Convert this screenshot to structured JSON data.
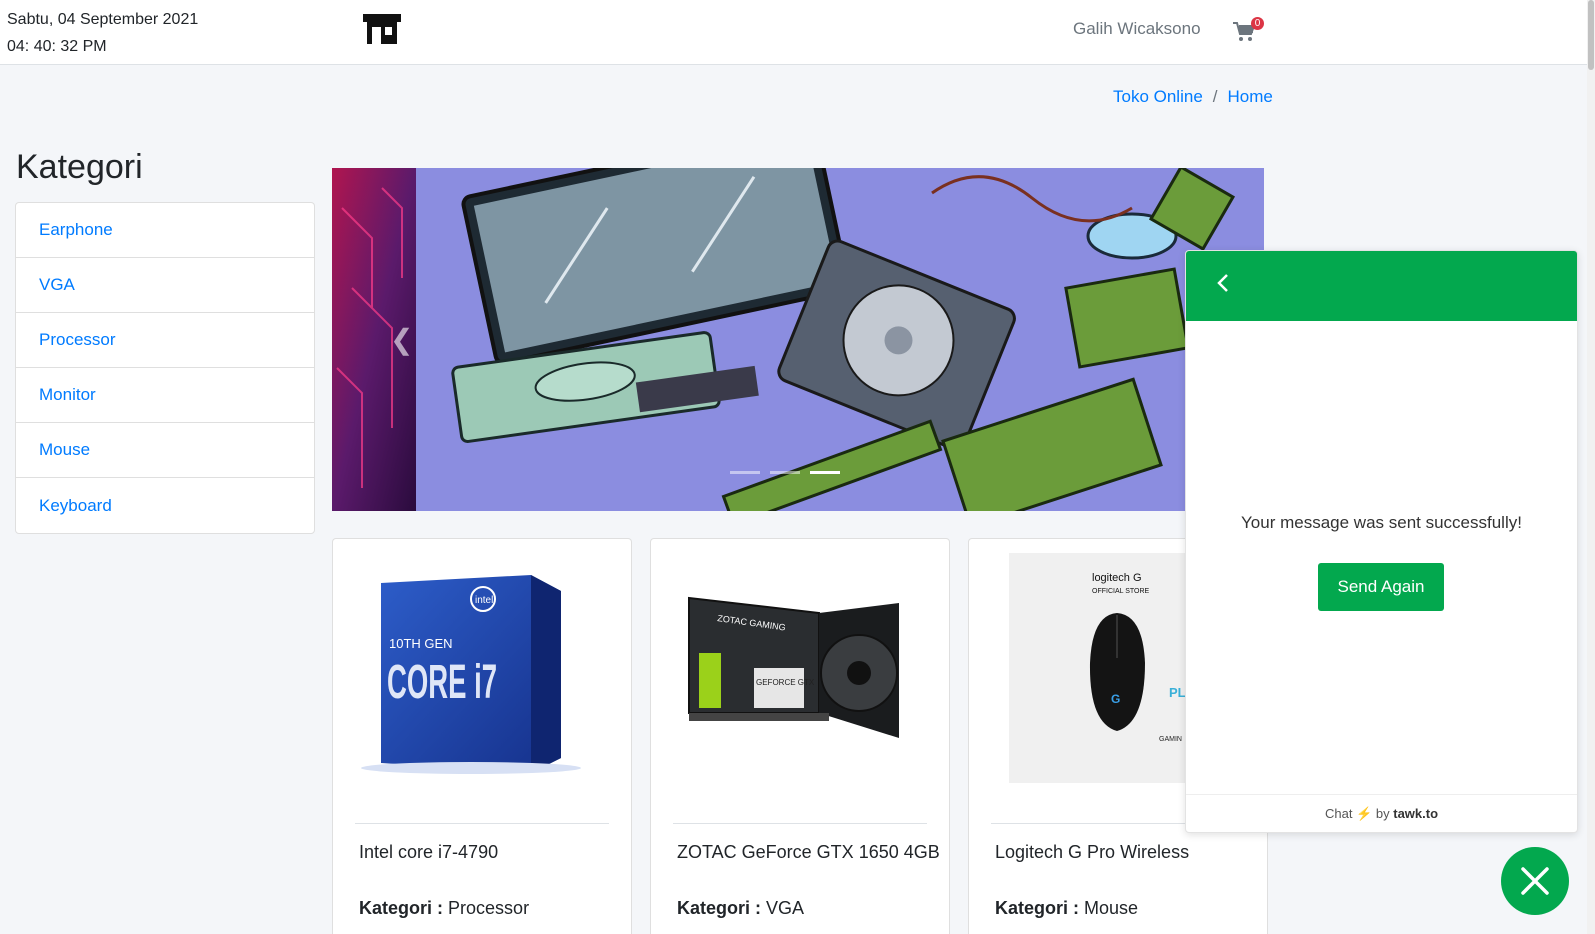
{
  "header": {
    "date": "Sabtu, 04 September 2021",
    "time": "04: 40: 32 PM",
    "store_icon": "store-icon",
    "user_name": "Galih Wicaksono",
    "cart_icon": "shopping-cart-icon",
    "cart_count": "0"
  },
  "breadcrumb": {
    "items": [
      "Toko Online",
      "Home"
    ],
    "separator": "/"
  },
  "sidebar": {
    "title": "Kategori",
    "items": [
      {
        "label": "Earphone"
      },
      {
        "label": "VGA"
      },
      {
        "label": "Processor"
      },
      {
        "label": "Monitor"
      },
      {
        "label": "Mouse"
      },
      {
        "label": "Keyboard"
      }
    ]
  },
  "carousel": {
    "prev_icon": "chevron-left-icon",
    "indicator_count": 3,
    "active_indicator": 3
  },
  "products": [
    {
      "name": "Intel core i7-4790",
      "category_label": "Kategori :",
      "category": "Processor",
      "image": "intel-core-i7-box"
    },
    {
      "name": "ZOTAC GeForce GTX 1650 4GB",
      "category_label": "Kategori :",
      "category": "VGA",
      "image": "zotac-gtx-1650-card"
    },
    {
      "name": "Logitech G Pro Wireless",
      "category_label": "Kategori :",
      "category": "Mouse",
      "image": "logitech-g-pro-mouse"
    }
  ],
  "product_image_text": {
    "intel_brand": "intel",
    "intel_gen": "10TH GEN",
    "intel_model": "CORE i7",
    "zotac_brand": "ZOTAC GAMING",
    "zotac_gpu": "GEFORCE GTX",
    "logitech_brand": "logitech G",
    "logitech_store": "OFFICIAL STORE",
    "logitech_side1": "PLA",
    "logitech_side2": "GAMIN"
  },
  "chat": {
    "back_icon": "chevron-left-icon",
    "message": "Your message was sent successfully!",
    "send_again_label": "Send Again",
    "footer_prefix": "Chat",
    "footer_by": "by",
    "footer_brand": "tawk.to",
    "close_icon": "close-icon",
    "accent": "#03a84e"
  },
  "colors": {
    "link": "#007bff",
    "badge": "#dc3545",
    "page_bg": "#f4f6f9"
  }
}
